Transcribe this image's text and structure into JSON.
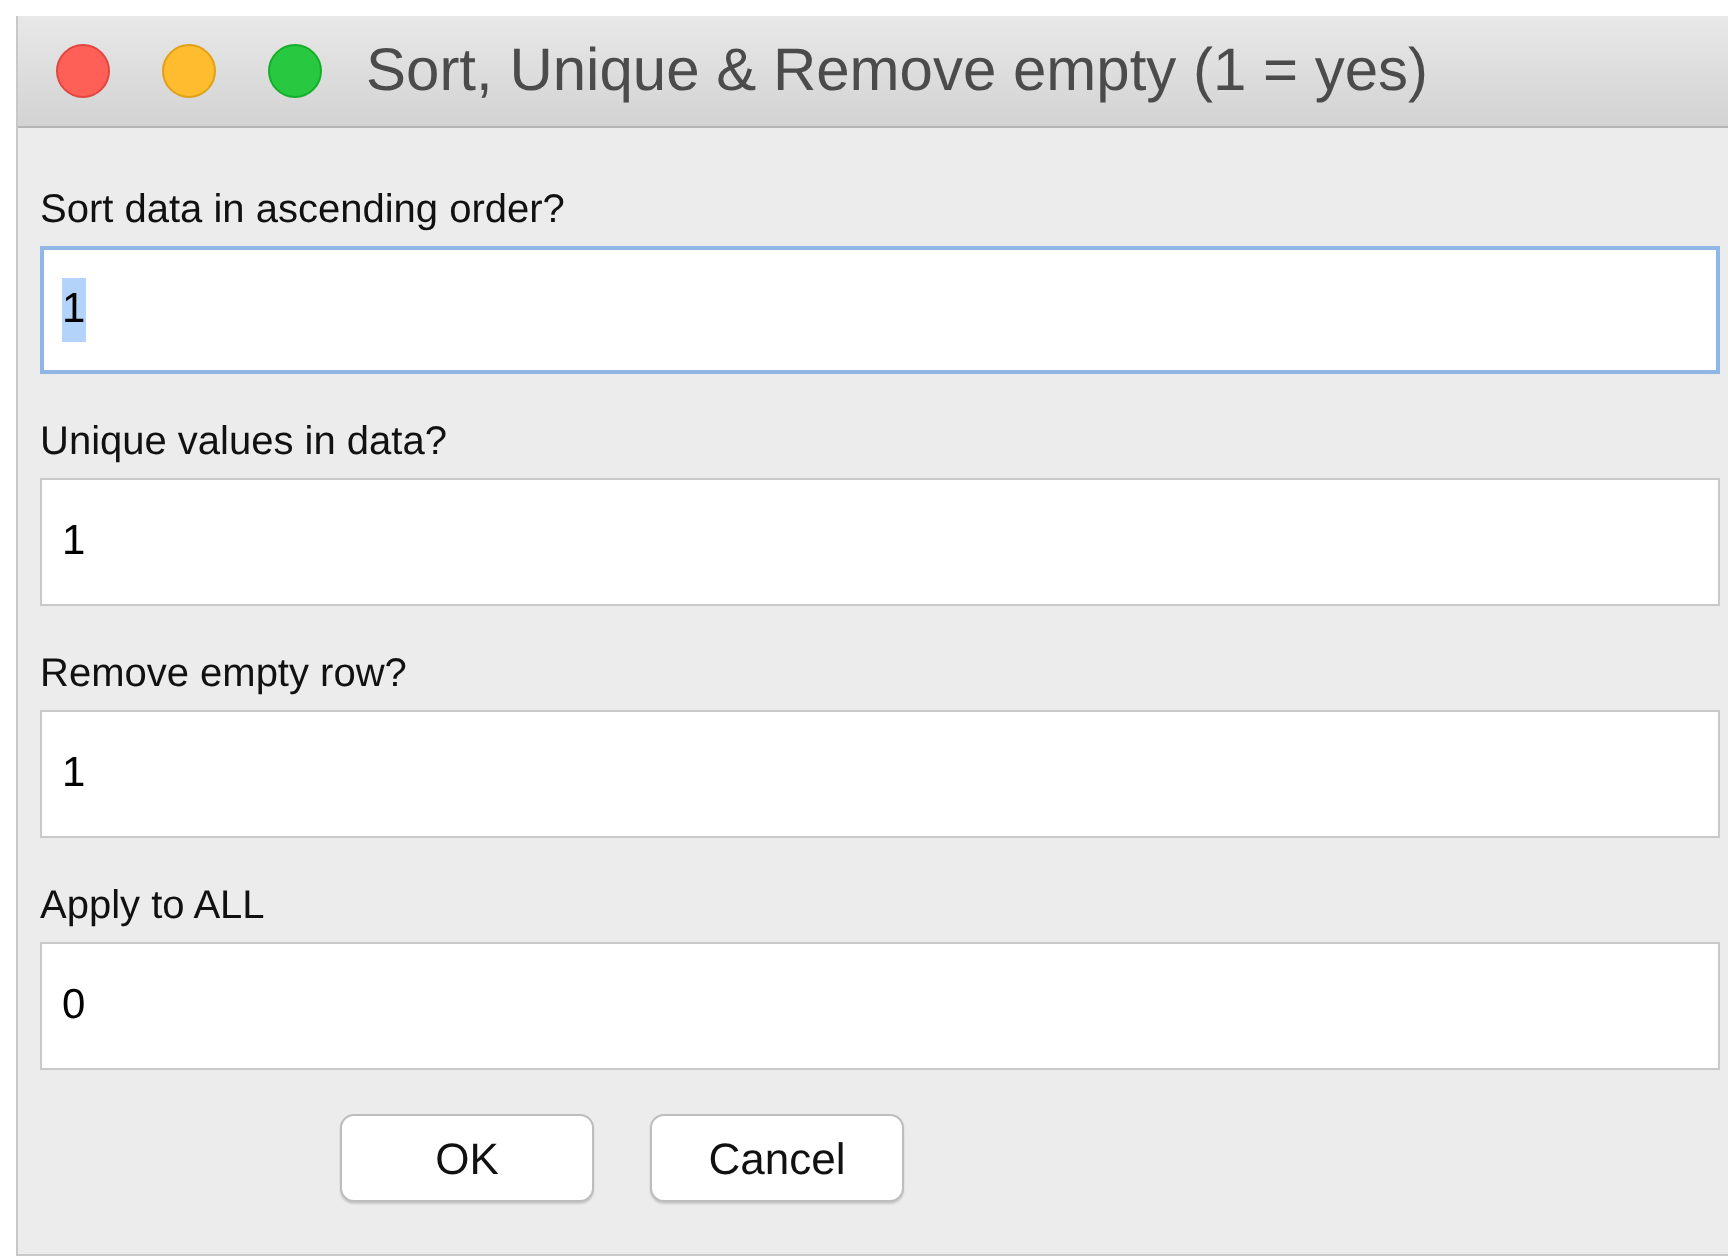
{
  "window": {
    "title": "Sort, Unique & Remove empty (1 = yes)"
  },
  "fields": [
    {
      "label": "Sort data in ascending order?",
      "value": "1",
      "focused": true
    },
    {
      "label": "Unique values in data?",
      "value": "1",
      "focused": false
    },
    {
      "label": "Remove empty row?",
      "value": "1",
      "focused": false
    },
    {
      "label": "Apply to ALL",
      "value": "0",
      "focused": false
    }
  ],
  "buttons": [
    "OK",
    "Cancel"
  ]
}
